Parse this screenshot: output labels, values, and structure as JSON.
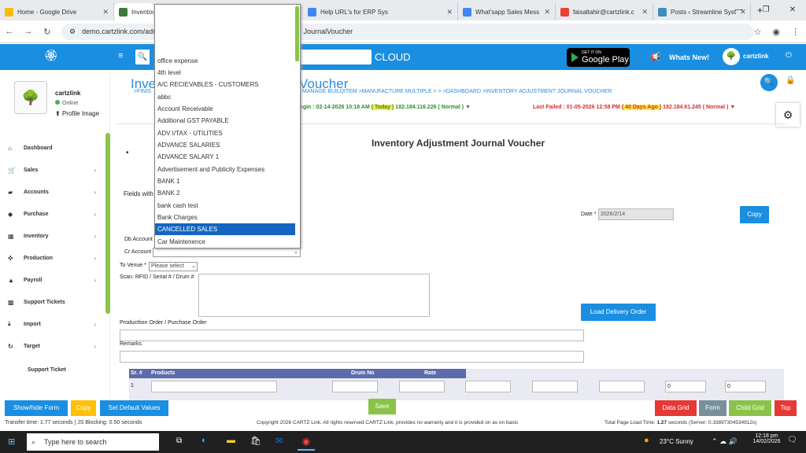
{
  "browser": {
    "tabs": [
      {
        "label": "Home - Google Drive",
        "color": "#fbbc04"
      },
      {
        "label": "Inventor",
        "color": "#3a7d3a"
      },
      {
        "label": "Help URL's for ERP Sys",
        "color": "#4285f4"
      },
      {
        "label": "What'sapp Sales Mess",
        "color": "#4285f4"
      },
      {
        "label": "faisaltahir@cartzlink.c",
        "color": "#ea4335"
      },
      {
        "label": "Posts ‹ Streamline Syst",
        "color": "#3c8dbc"
      }
    ],
    "url": "demo.cartzlink.com/adm",
    "url_tail": "JournalVoucher"
  },
  "appbar": {
    "cloud": "CLOUD",
    "gplay_top": "GET IT ON",
    "gplay_main": "Google Play",
    "whats_new": "Whats New!",
    "user": "cartzlink"
  },
  "sidebar": {
    "name": "cartzlink",
    "online": "Online",
    "profile_image": "Profile Image",
    "items": [
      {
        "label": "Dashboard",
        "icon": "home-icon",
        "chevron": false
      },
      {
        "label": "Sales",
        "icon": "cart-icon",
        "chevron": true
      },
      {
        "label": "Accounts",
        "icon": "briefcase-icon",
        "chevron": true
      },
      {
        "label": "Purchase",
        "icon": "tag-icon",
        "chevron": true
      },
      {
        "label": "Inventory",
        "icon": "grid-icon",
        "chevron": true
      },
      {
        "label": "Production",
        "icon": "production-icon",
        "chevron": true
      },
      {
        "label": "Payroll",
        "icon": "payroll-icon",
        "chevron": true
      },
      {
        "label": "Support Tickets",
        "icon": "ticket-icon",
        "chevron": false
      },
      {
        "label": "Import",
        "icon": "import-icon",
        "chevron": true
      },
      {
        "label": "Target",
        "icon": "target-icon",
        "chevron": true
      },
      {
        "label": "Support Ticket",
        "icon": "",
        "chevron": false
      }
    ]
  },
  "header": {
    "title_left": "Inve",
    "title_right": "Voucher",
    "breadcrumb_left": ">FINIS",
    "breadcrumb_right": "MANAGE BUILDITEM  >MANUFACTURE MULTIPLE  > >  >DASHBOARD  >INVENTORY ADJUSTMENT JOURNAL VOUCHER",
    "login_prefix": "t Login : 02-14-2026 10:18 AM ",
    "login_today": "( Today )",
    "login_suffix": " 182.184.116.226 ( Normal ) ▼",
    "failed_prefix": "Last Failed : 01-05-2026 12:58 PM ",
    "failed_ago": "( 40 Days Ago )",
    "failed_suffix": " 182.184.61.245 ( Normal ) ▼"
  },
  "form": {
    "title": "Inventory Adjustment Journal Voucher",
    "fields_with": "Fields with",
    "date_label": "Date *",
    "date_value": "2026/2/14",
    "copy_label": "Copy",
    "db_account": "Db Account",
    "cr_account": "Cr Account",
    "to_venue": "To Venue *",
    "venue_placeholder": "Please select",
    "scan_label": "Scan: RFID / Serial # / Drum #",
    "load_delivery": "Load Delivery Order",
    "production_order": "Producttion Order / Purchase Order",
    "remarks": "Remarks"
  },
  "grid": {
    "headers": [
      "Sr. #",
      "Products",
      "Drum No",
      "Rate"
    ],
    "row_no": "1",
    "qty_a": "0",
    "qty_b": "0"
  },
  "dropdown": {
    "selected": "CANCELLED SALES",
    "options": [
      "",
      "",
      "",
      "office expense",
      "4th level",
      "A/C RECIEVABLES - CUSTOMERS",
      "abbc",
      "Account Receivable",
      "Additional GST PAYABLE",
      "ADV I/TAX - UTILITIES",
      "ADVANCE SALARIES",
      "ADVANCE SALARY 1",
      "Advertisement and Publicity Expenses",
      "BANK 1",
      "BANK 2",
      "bank cash test",
      "Bank Charges",
      "CANCELLED SALES",
      "Car Maintenence"
    ]
  },
  "bottom": {
    "show_hide": "Show/hide Form",
    "copy": "Copy",
    "set_default": "Set Default Values",
    "save": "Save",
    "data_grid": "Data Grid",
    "form": "Form",
    "child_grid": "Child Grid",
    "top": "Top"
  },
  "status": {
    "left": "Transfer time: 1.77 seconds  |  JS Blocking: 0.50 seconds",
    "center": "Copyright 2026 CARTZ Link. All rights reserved CARTZ Link. provides no warranty and it is provided on as on basis",
    "right_prefix": "Total Page Load Time: ",
    "right_bold": "1.27",
    "right_suffix": " seconds (Server: 0.33897304534912s)"
  },
  "taskbar": {
    "search": "Type here to search",
    "weather": "23°C  Sunny",
    "time": "12:18 pm",
    "date": "14/02/2026"
  }
}
